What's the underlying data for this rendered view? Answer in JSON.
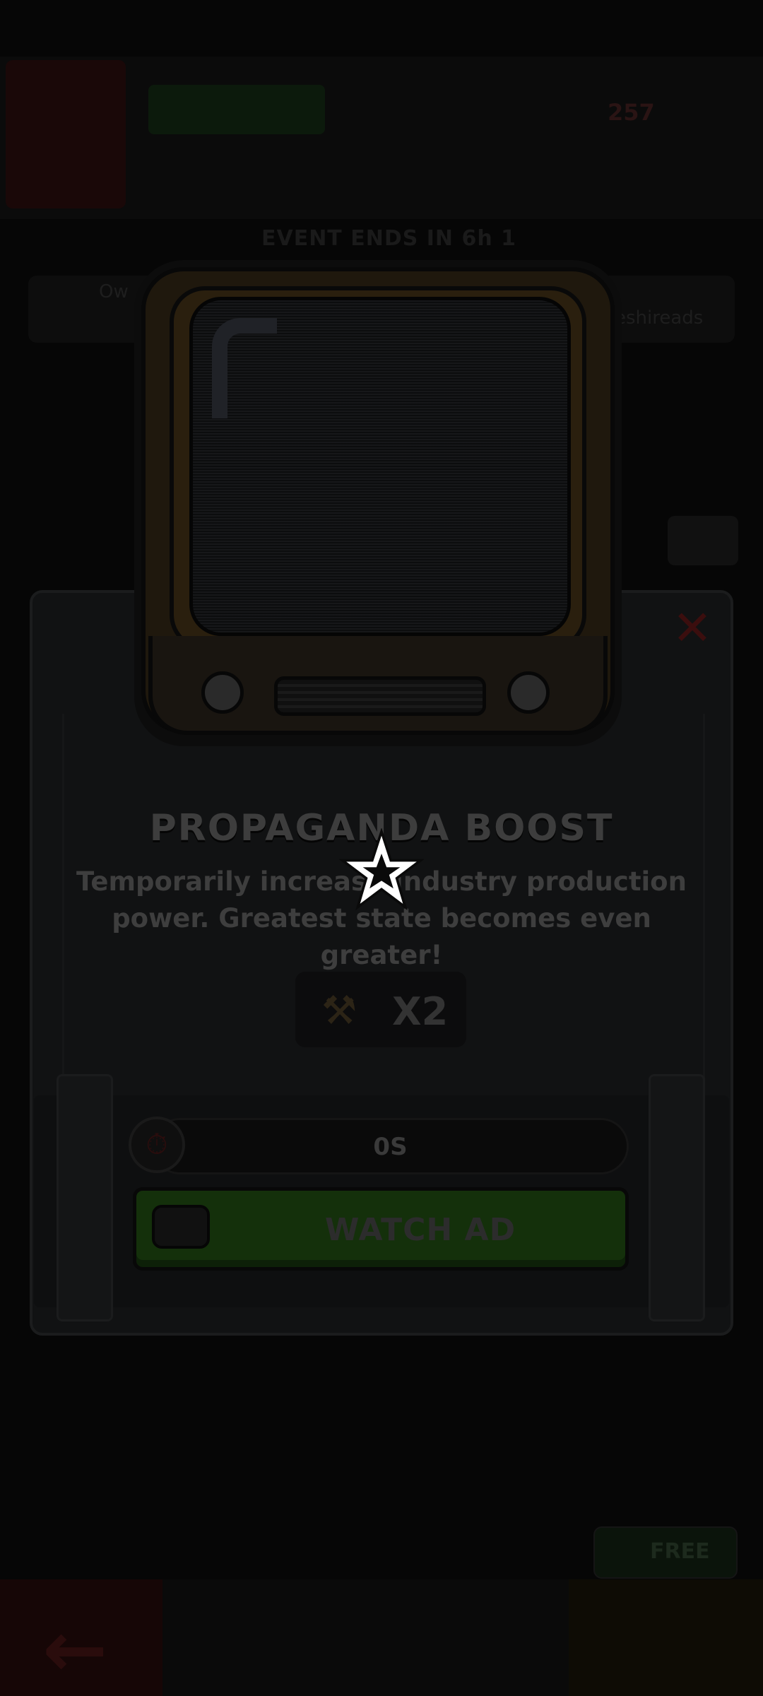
{
  "background": {
    "gem_count": "257",
    "event_text": "EVENT ENDS IN 6h 1",
    "row_left_text": "Ow",
    "row_right_text": "eshireads",
    "free_label": "FREE"
  },
  "modal": {
    "title": "PROPAGANDA BOOST",
    "description": "Temporarily increase Industry production power. Greatest state becomes even greater!",
    "multiplier": "X2",
    "timer": "0S",
    "watch_button": "WATCH AD"
  },
  "icons": {
    "close": "close-icon",
    "hammer": "hammer-icon",
    "stopwatch": "stopwatch-icon",
    "tv": "tv-icon",
    "loading": "star-loading-icon",
    "back": "back-arrow-icon"
  },
  "colors": {
    "overlay": "#060606",
    "watch_button": "#14300b",
    "close": "#3b0e0e"
  }
}
